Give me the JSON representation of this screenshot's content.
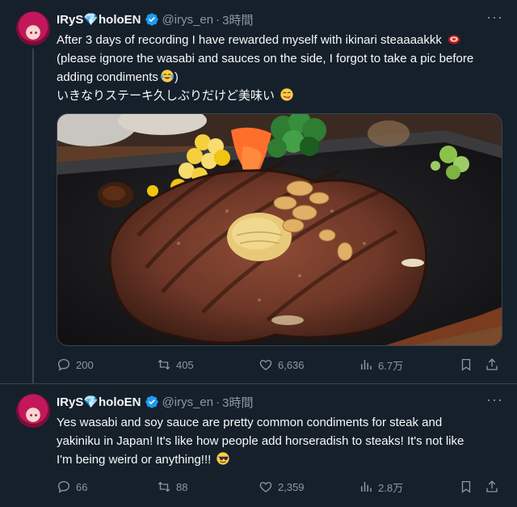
{
  "tweets": [
    {
      "author": {
        "name": "IRyS💎holoEN",
        "handle": "@irys_en",
        "separator": "·",
        "time": "3時間"
      },
      "text": {
        "line1": "After 3 days of recording I have rewarded myself with ikinari steaaaakkk",
        "line2": "(please ignore the wasabi and sauces on the side, I forgot to take a pic before",
        "line3": "adding condiments",
        "line3_tail": ")",
        "line4": "いきなりステーキ久しぶりだけど美味い"
      },
      "stats": {
        "replies": "200",
        "reposts": "405",
        "likes": "6,636",
        "views": "6.7万"
      }
    },
    {
      "author": {
        "name": "IRyS💎holoEN",
        "handle": "@irys_en",
        "separator": "·",
        "time": "3時間"
      },
      "text": {
        "line1": "Yes wasabi and soy sauce are pretty common condiments for steak and",
        "line2": "yakiniku in Japan! It's like how people add horseradish to steaks! It's not like",
        "line3": "I'm being weird or anything!!!"
      },
      "stats": {
        "replies": "66",
        "reposts": "88",
        "likes": "2,359",
        "views": "2.8万"
      }
    }
  ],
  "colors": {
    "background": "#15202b",
    "text": "#f7f9f9",
    "muted": "#8b98a5",
    "verified": "#1d9bf0",
    "divider": "#38444d"
  },
  "icons": [
    "more-icon",
    "verified-icon",
    "reply-icon",
    "repost-icon",
    "like-icon",
    "views-icon",
    "bookmark-icon",
    "share-icon"
  ]
}
